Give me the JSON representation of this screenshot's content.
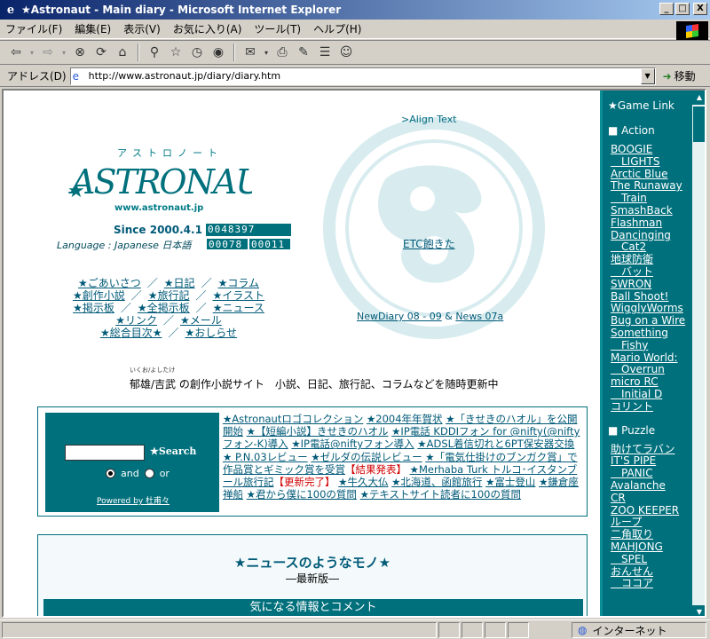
{
  "window": {
    "title": "★Astronaut - Main diary - Microsoft Internet Explorer",
    "minimize": "_",
    "maximize": "□",
    "close": "X"
  },
  "menu": [
    "ファイル(F)",
    "編集(E)",
    "表示(V)",
    "お気に入り(A)",
    "ツール(T)",
    "ヘルプ(H)"
  ],
  "address": {
    "label": "アドレス(D)",
    "url": "http://www.astronaut.jp/diary/diary.htm",
    "go_label": "移動"
  },
  "logo": {
    "name": "ASTRONAUT",
    "katakana": "アストロノート",
    "url": "www.astronaut.jp"
  },
  "site": {
    "since": "Since 2000.4.1",
    "counter_total": "0048397",
    "language": "Language : Japanese 日本語",
    "counter_a": "00078",
    "counter_b": "00011",
    "align_text": ">Align Text",
    "etc": "ETC飽きた",
    "newdiary": "NewDiary 08 - 09",
    "amp": "&",
    "news": "News 07a",
    "ruby": "いくお/よしたけ",
    "intro": "郁雄/吉武 の創作小説サイト　小説、日記、旅行記、コラムなどを随時更新中"
  },
  "nav": [
    [
      "★ごあいさつ",
      "★日記",
      "★コラム"
    ],
    [
      "★創作小説",
      "★旅行記",
      "★イラスト"
    ],
    [
      "★掲示板",
      "★全掲示板",
      "★ニュース"
    ],
    [
      "★リンク",
      "★メール"
    ],
    [
      "★総合目次★",
      "★おしらせ"
    ]
  ],
  "search": {
    "button": "★Search",
    "and": "and",
    "or": "or",
    "powered": "Powered by 杜甫々"
  },
  "news_links": [
    {
      "text": "★Astronautロゴコレクション",
      "red": ""
    },
    {
      "text": "★2004年年賀状",
      "red": ""
    },
    {
      "text": "★「きせきのハオル」を公開開始",
      "red": ""
    },
    {
      "text": "★【短編小説】きせきのハオル",
      "red": ""
    },
    {
      "text": "★IP電話 KDDIフォン for @nifty(@niftyフォン-K)導入",
      "red": ""
    },
    {
      "text": "★IP電話@niftyフォン導入",
      "red": ""
    },
    {
      "text": "★ADSL着信切れと6PT保安器交換",
      "red": ""
    },
    {
      "text": "★ P.N.03レビュー",
      "red": ""
    },
    {
      "text": "★ゼルダの伝説レビュー",
      "red": ""
    },
    {
      "text": "★「電気仕掛けのブンガク賞」で作品賞とギミック賞を受賞",
      "red": "【結果発表】"
    },
    {
      "text": "★Merhaba Turk トルコ･イスタンブール旅行記",
      "red": "【更新完了】"
    },
    {
      "text": "★牛久大仏",
      "red": ""
    },
    {
      "text": "★北海道、函館旅行",
      "red": ""
    },
    {
      "text": "★富士登山",
      "red": ""
    },
    {
      "text": "★鎌倉座禅船",
      "red": ""
    },
    {
      "text": "★君から僕に100の質問",
      "red": ""
    },
    {
      "text": "★テキストサイト読者に100の質問",
      "red": ""
    }
  ],
  "news_section": {
    "title": "★ニュースのようなモノ★",
    "subtitle": "―最新版―",
    "band": "気になる情報とコメント"
  },
  "sidebar": {
    "heading": "★Game Link",
    "cat_action": "■ Action",
    "action": [
      "BOOGIE",
      "　LIGHTS",
      "Arctic Blue",
      "The Runaway",
      "　Train",
      "SmashBack",
      "Flashman",
      "Dancinging",
      "　Cat2",
      "地球防衛",
      "　バット",
      "SWRON",
      "Ball Shoot!",
      "WigglyWorms",
      "Bug on a Wire",
      "Something",
      "　Fishy",
      "Mario World:",
      "　Overrun",
      "micro RC",
      "　Initial D",
      "コリント"
    ],
    "cat_puzzle": "■ Puzzle",
    "puzzle": [
      "助けてラバン",
      "IT'S PIPE",
      "　PANIC",
      "Avalanche",
      "CR",
      "ZOO KEEPER",
      "ループ",
      "二角取り",
      "MAHJONG",
      "　SPEL",
      "おんせん",
      "　ココア"
    ]
  },
  "status": {
    "zone": "インターネット"
  },
  "colors": {
    "teal": "#00707c",
    "link": "#005a78",
    "red": "#d00000"
  }
}
